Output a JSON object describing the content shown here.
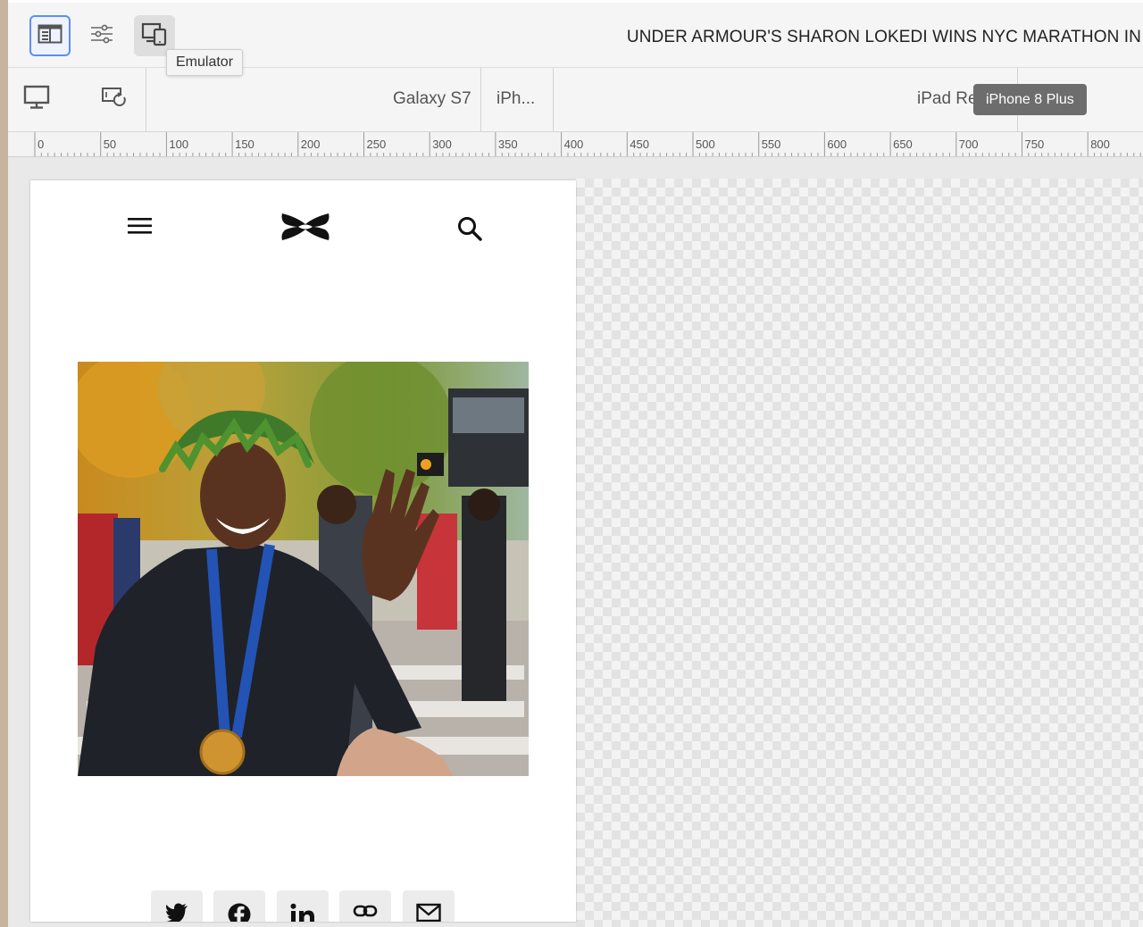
{
  "toolbar": {
    "page_title": "UNDER ARMOUR'S SHARON LOKEDI WINS NYC MARATHON IN",
    "tooltip": "Emulator",
    "icons": [
      "side-panel-icon",
      "properties-sliders-icon",
      "emulator-icon"
    ]
  },
  "devicebar": {
    "devices": [
      "Galaxy S7",
      "iPh...",
      "iPad Re"
    ],
    "selected_badge": "iPhone 8 Plus",
    "icons": [
      "desktop-icon",
      "rotate-device-icon"
    ]
  },
  "ruler": {
    "labels": [
      "0",
      "50",
      "100",
      "150",
      "200",
      "250",
      "300",
      "350",
      "400",
      "450",
      "500",
      "550",
      "600",
      "650",
      "700",
      "750",
      "800"
    ]
  },
  "site": {
    "icons": [
      "hamburger-menu-icon",
      "under-armour-logo",
      "search-icon"
    ],
    "share_icons": [
      "twitter-icon",
      "facebook-icon",
      "linkedin-icon",
      "link-icon",
      "email-icon"
    ]
  },
  "colors": {
    "selected_border": "#5c8ff0",
    "badge_bg": "#6d6d6d",
    "page_bg": "#ffffff",
    "ui_bg": "#f5f5f5"
  }
}
